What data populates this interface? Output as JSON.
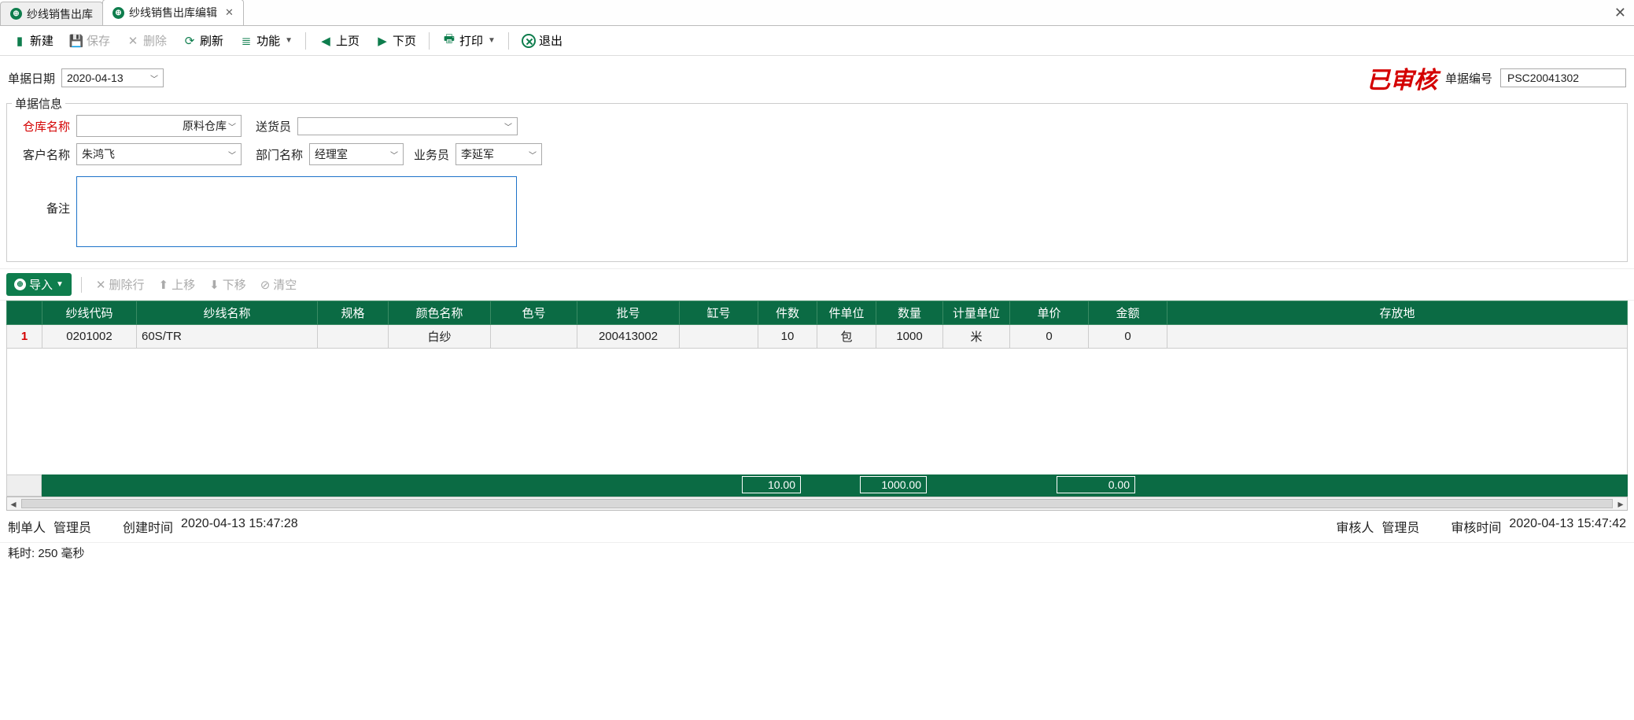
{
  "tabs": [
    {
      "label": "纱线销售出库",
      "active": false
    },
    {
      "label": "纱线销售出库编辑",
      "active": true
    }
  ],
  "toolbar": {
    "new": "新建",
    "save": "保存",
    "delete": "删除",
    "refresh": "刷新",
    "functions": "功能",
    "prev": "上页",
    "next": "下页",
    "print": "打印",
    "exit": "退出"
  },
  "header": {
    "date_label": "单据日期",
    "date_value": "2020-04-13",
    "stamp": "已审核",
    "billno_label": "单据编号",
    "billno_value": "PSC20041302"
  },
  "info": {
    "legend": "单据信息",
    "warehouse_label": "仓库名称",
    "warehouse_value": "原料仓库",
    "deliverer_label": "送货员",
    "deliverer_value": "",
    "customer_label": "客户名称",
    "customer_value": "朱鸿飞",
    "dept_label": "部门名称",
    "dept_value": "经理室",
    "salesman_label": "业务员",
    "salesman_value": "李延军",
    "remark_label": "备注",
    "remark_value": ""
  },
  "mid_toolbar": {
    "import": "导入",
    "delete_row": "删除行",
    "move_up": "上移",
    "move_down": "下移",
    "clear": "清空"
  },
  "grid": {
    "columns": [
      "纱线代码",
      "纱线名称",
      "规格",
      "颜色名称",
      "色号",
      "批号",
      "缸号",
      "件数",
      "件单位",
      "数量",
      "计量单位",
      "单价",
      "金额",
      "存放地"
    ],
    "rows": [
      {
        "num": "1",
        "code": "0201002",
        "name": "60S/TR",
        "spec": "",
        "color": "白纱",
        "colorno": "",
        "batch": "200413002",
        "vat": "",
        "pieces": "10",
        "piece_unit": "包",
        "qty": "1000",
        "unit": "米",
        "price": "0",
        "amount": "0",
        "location": ""
      }
    ],
    "summary": {
      "pieces": "10.00",
      "qty": "1000.00",
      "amount": "0.00"
    }
  },
  "footer": {
    "creator_label": "制单人",
    "creator": "管理员",
    "create_time_label": "创建时间",
    "create_time": "2020-04-13 15:47:28",
    "auditor_label": "审核人",
    "auditor": "管理员",
    "audit_time_label": "审核时间",
    "audit_time": "2020-04-13 15:47:42"
  },
  "status": "耗时: 250 毫秒"
}
